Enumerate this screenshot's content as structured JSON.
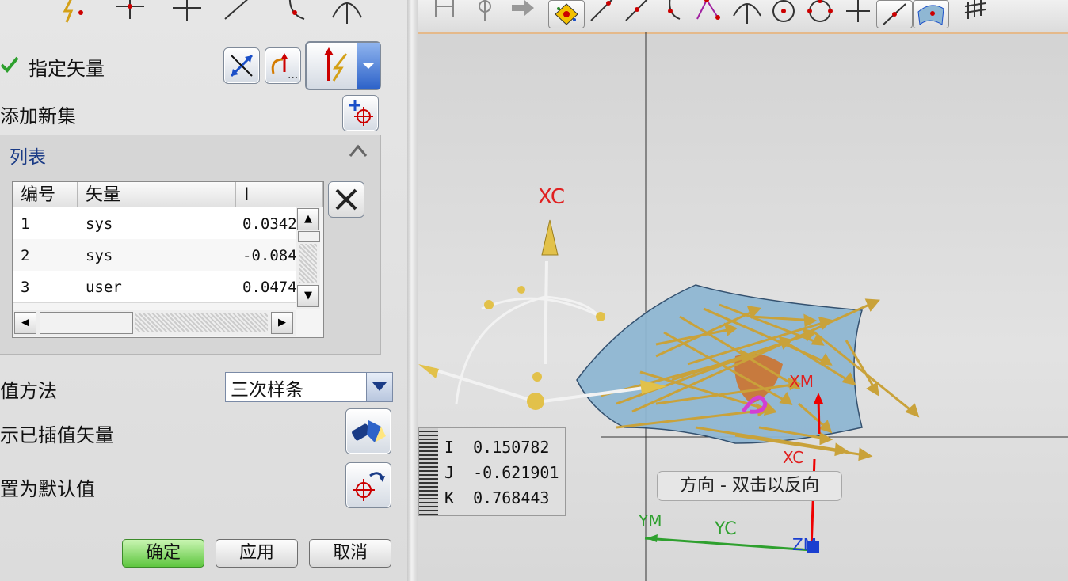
{
  "dialog": {
    "specify_vector_label": "指定矢量",
    "add_new_set_label": "添加新集",
    "list_section": {
      "title": "列表",
      "collapse_icon": "chevron-up-icon",
      "columns": [
        "编号",
        "矢量",
        "I"
      ],
      "rows": [
        {
          "no": "1",
          "vector": "sys",
          "i": "0.0342"
        },
        {
          "no": "2",
          "vector": "sys",
          "i": "-0.084"
        },
        {
          "no": "3",
          "vector": "user",
          "i": "0.0474"
        }
      ]
    },
    "interp_method_label": "值方法",
    "interp_method_value": "三次样条",
    "show_interp_label": "示已插值矢量",
    "reset_default_label": "置为默认值",
    "buttons": {
      "ok": "确定",
      "apply": "应用",
      "cancel": "取消"
    }
  },
  "viewport": {
    "axis_labels": {
      "xc_top": "XC",
      "xc_small": "XC",
      "ym": "YM",
      "yc": "YC",
      "zm": "ZM",
      "xm": "XM"
    },
    "readout": {
      "i_label": "I",
      "i_value": "0.150782",
      "j_label": "J",
      "j_value": "-0.621901",
      "k_label": "K",
      "k_value": "0.768443"
    },
    "tooltip": "方向 - 双击以反向"
  },
  "colors": {
    "accent_orange": "#e5b98a",
    "arrow_gold": "#c9a23a",
    "surface_blue": "#8fb7d3",
    "ok_green": "#5ec63f"
  }
}
